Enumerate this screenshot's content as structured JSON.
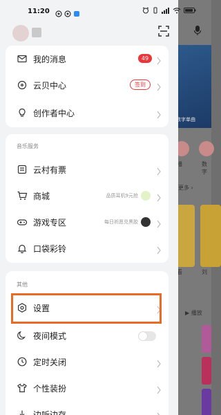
{
  "status_bar": {
    "time": "11:20",
    "right_text": "ℝ"
  },
  "background": {
    "banner_text": "数字单曲",
    "cat_labels": [
      "播",
      "数字"
    ],
    "more": "更多 ›",
    "card_labels": [
      "看",
      "刘"
    ],
    "play": "▶ 播放"
  },
  "menu": {
    "group1": {
      "items": [
        {
          "label": "我的消息",
          "icon": "envelope-icon",
          "badge": "49"
        },
        {
          "label": "云贝中心",
          "icon": "coin-icon",
          "tag": "签到"
        },
        {
          "label": "创作者中心",
          "icon": "bulb-icon"
        }
      ]
    },
    "group2": {
      "title": "音乐服务",
      "items": [
        {
          "label": "云村有票",
          "icon": "ticket-icon"
        },
        {
          "label": "商城",
          "icon": "cart-icon",
          "extra": "品质耳机9元抢"
        },
        {
          "label": "游戏专区",
          "icon": "gamepad-icon",
          "extra": "每日祈愿兑黑胶"
        },
        {
          "label": "口袋彩铃",
          "icon": "bell-icon"
        }
      ]
    },
    "group3": {
      "title": "其他",
      "items": [
        {
          "label": "设置",
          "icon": "gear-icon"
        },
        {
          "label": "夜间模式",
          "icon": "moon-icon",
          "toggle": false
        },
        {
          "label": "定时关闭",
          "icon": "clock-icon"
        },
        {
          "label": "个性装扮",
          "icon": "shirt-icon"
        },
        {
          "label": "边听边存",
          "icon": "download-icon"
        }
      ]
    }
  },
  "colors": {
    "accent": "#e9363b",
    "highlight": "#ea6a24"
  }
}
